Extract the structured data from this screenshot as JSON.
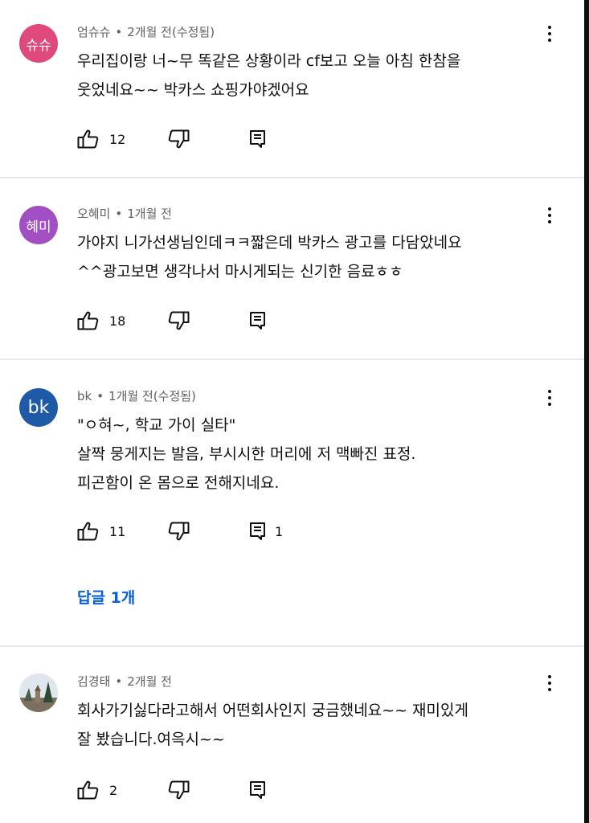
{
  "comments": [
    {
      "avatar_text": "슈슈",
      "avatar_color": "#e0497b",
      "author": "엄슈슈",
      "separator": "•",
      "time": "2개월 전(수정됨)",
      "text": "우리집이랑 너~무 똑같은 상황이라  cf보고 오늘 아침 한참을\n웃었네요~~  박카스 쇼핑가야겠어요",
      "likes": "12",
      "replies": ""
    },
    {
      "avatar_text": "혜미",
      "avatar_color": "#a34fc4",
      "author": "오혜미",
      "separator": "•",
      "time": "1개월 전",
      "text": "가야지 니가선생님인데ㅋㅋ짧은데 박카스 광고를 다담았네요\n^^광고보면 생각나서 마시게되는 신기한 음료ㅎㅎ",
      "likes": "18",
      "replies": ""
    },
    {
      "avatar_text": "bk",
      "avatar_color": "#1f5aa6",
      "author": "bk",
      "separator": "•",
      "time": "1개월 전(수정됨)",
      "text": "\"ㅇ혀~, 학교 가이 실타\"\n살짝 뭉게지는 발음, 부시시한 머리에 저 맥빠진 표정.\n피곤함이 온 몸으로 전해지네요.",
      "likes": "11",
      "replies": "1",
      "replies_link": "답글 1개"
    },
    {
      "avatar_text": "",
      "avatar_color": "#c9cfd6",
      "author": "김경태",
      "separator": "•",
      "time": "2개월 전",
      "text": "회사가기싫다라고해서 어떤회사인지 궁금했네요~~ 재미있게\n잘 봤습니다.여윽시~~",
      "likes": "2",
      "replies": ""
    }
  ],
  "icons": {
    "like": "thumb-up-icon",
    "dislike": "thumb-down-icon",
    "reply": "comment-reply-icon",
    "more": "more-vert-icon"
  }
}
